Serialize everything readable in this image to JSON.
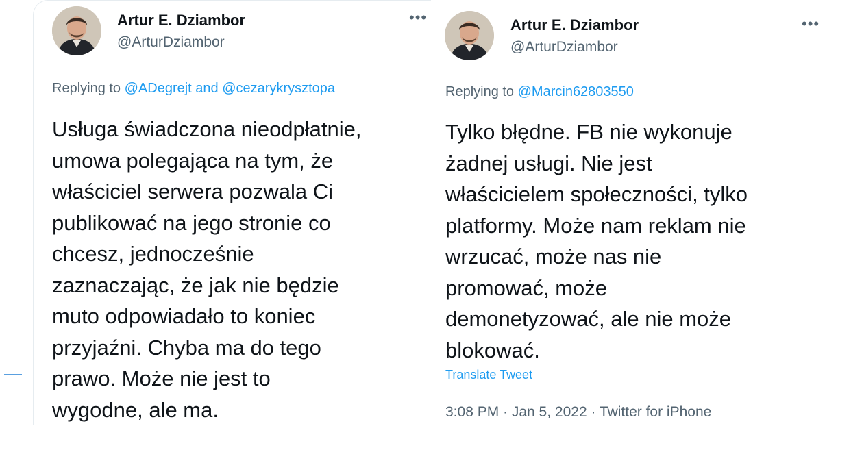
{
  "tweets": [
    {
      "author": {
        "name": "Artur E. Dziambor",
        "handle": "@ArturDziambor"
      },
      "more_icon": "more-horizontal-icon",
      "replying": {
        "prefix": "Replying to",
        "mentions": "@ADegrejt and @cezarykrysztopa"
      },
      "body": [
        "Usługa świadczona nieodpłatnie,",
        "umowa polegająca na tym, że",
        "właściciel serwera pozwala Ci",
        "publikować na jego stronie co",
        "chcesz, jednocześnie",
        "zaznaczając, że jak nie będzie",
        "muto odpowiadało to koniec",
        "przyjaźni. Chyba ma do tego",
        "prawo. Może nie jest to",
        "wygodne, ale ma."
      ]
    },
    {
      "author": {
        "name": "Artur E. Dziambor",
        "handle": "@ArturDziambor"
      },
      "more_icon": "more-horizontal-icon",
      "replying": {
        "prefix": "Replying to",
        "mentions": "@Marcin62803550"
      },
      "body": [
        "Tylko błędne. FB nie wykonuje",
        "żadnej usługi. Nie jest",
        "właścicielem społeczności, tylko",
        "platformy. Może nam reklam nie",
        "wrzucać, może nas nie",
        "promować, może",
        "demonetyzować, ale nie może",
        "blokować."
      ],
      "translate_label": "Translate Tweet",
      "meta": "3:08 PM · Jan 5, 2022 · Twitter for iPhone"
    }
  ],
  "colors": {
    "accent": "#1d9bf0",
    "secondary_text": "#536471",
    "primary_text": "#0f1419"
  }
}
